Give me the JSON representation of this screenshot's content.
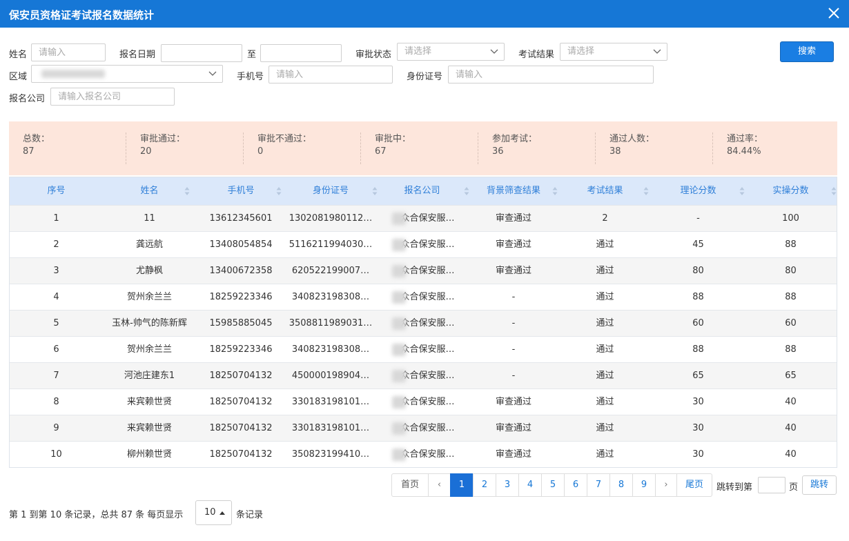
{
  "window": {
    "title": "保安员资格证考试报名数据统计"
  },
  "filters": {
    "name": {
      "label": "姓名",
      "placeholder": "请输入"
    },
    "signup_date": {
      "label": "报名日期",
      "separator": "至"
    },
    "approval_status": {
      "label": "审批状态",
      "placeholder": "请选择"
    },
    "exam_result": {
      "label": "考试结果",
      "placeholder": "请选择"
    },
    "search_label": "搜索",
    "region": {
      "label": "区域"
    },
    "phone": {
      "label": "手机号",
      "placeholder": "请输入"
    },
    "id_number": {
      "label": "身份证号",
      "placeholder": "请输入"
    },
    "company": {
      "label": "报名公司",
      "placeholder": "请输入报名公司"
    }
  },
  "stats": [
    {
      "label": "总数：",
      "value": "87"
    },
    {
      "label": "审批通过：",
      "value": "20"
    },
    {
      "label": "审批不通过：",
      "value": "0"
    },
    {
      "label": "审批中：",
      "value": "67"
    },
    {
      "label": "参加考试：",
      "value": "36"
    },
    {
      "label": "通过人数：",
      "value": "38"
    },
    {
      "label": "通过率：",
      "value": "84.44%"
    }
  ],
  "table": {
    "columns": [
      "序号",
      "姓名",
      "手机号",
      "身份证号",
      "报名公司",
      "背景筛查结果",
      "考试结果",
      "理论分数",
      "实操分数"
    ],
    "rows": [
      [
        "1",
        "11",
        "13612345601",
        "1302081980112…",
        "众合保安服…",
        "审查通过",
        "2",
        "-",
        "100"
      ],
      [
        "2",
        "龚远航",
        "13408054854",
        "5116211994030…",
        "众合保安服…",
        "审查通过",
        "通过",
        "45",
        "88"
      ],
      [
        "3",
        "尤静枫",
        "13400672358",
        "620522199007…",
        "众合保安服…",
        "审查通过",
        "通过",
        "80",
        "80"
      ],
      [
        "4",
        "贺州余兰兰",
        "18259223346",
        "340823198308…",
        "众合保安服…",
        "-",
        "通过",
        "88",
        "88"
      ],
      [
        "5",
        "玉林-帅气的陈新辉",
        "15985885045",
        "3508811989031…",
        "众合保安服…",
        "-",
        "通过",
        "60",
        "60"
      ],
      [
        "6",
        "贺州余兰兰",
        "18259223346",
        "340823198308…",
        "众合保安服…",
        "-",
        "通过",
        "88",
        "88"
      ],
      [
        "7",
        "河池庄建东1",
        "18250704132",
        "450000198904…",
        "众合保安服…",
        "-",
        "通过",
        "65",
        "65"
      ],
      [
        "8",
        "来宾赖世贤",
        "18250704132",
        "330183198101…",
        "众合保安服…",
        "审查通过",
        "通过",
        "30",
        "40"
      ],
      [
        "9",
        "来宾赖世贤",
        "18250704132",
        "330183198101…",
        "众合保安服…",
        "审查通过",
        "通过",
        "30",
        "40"
      ],
      [
        "10",
        "柳州赖世贤",
        "18250704132",
        "350823199410…",
        "众合保安服…",
        "审查通过",
        "通过",
        "30",
        "40"
      ]
    ]
  },
  "pagination": {
    "first": "首页",
    "prev": "‹",
    "pages": [
      "1",
      "2",
      "3",
      "4",
      "5",
      "6",
      "7",
      "8",
      "9"
    ],
    "current": "1",
    "next": "›",
    "last": "尾页",
    "jump_prefix": "跳转到第",
    "jump_suffix": "页",
    "jump_button": "跳转"
  },
  "footer": {
    "summary": "第 1 到第 10 条记录，总共 87 条 每页显示",
    "page_size": "10",
    "suffix": "条记录"
  },
  "colors": {
    "accent": "#1677d6",
    "stats_bg": "#fde6dc",
    "header_bg": "#dbe8fa"
  },
  "icons": {
    "close": "close-icon",
    "dropdown": "chevron-down-icon",
    "sort": "sort-icon"
  }
}
